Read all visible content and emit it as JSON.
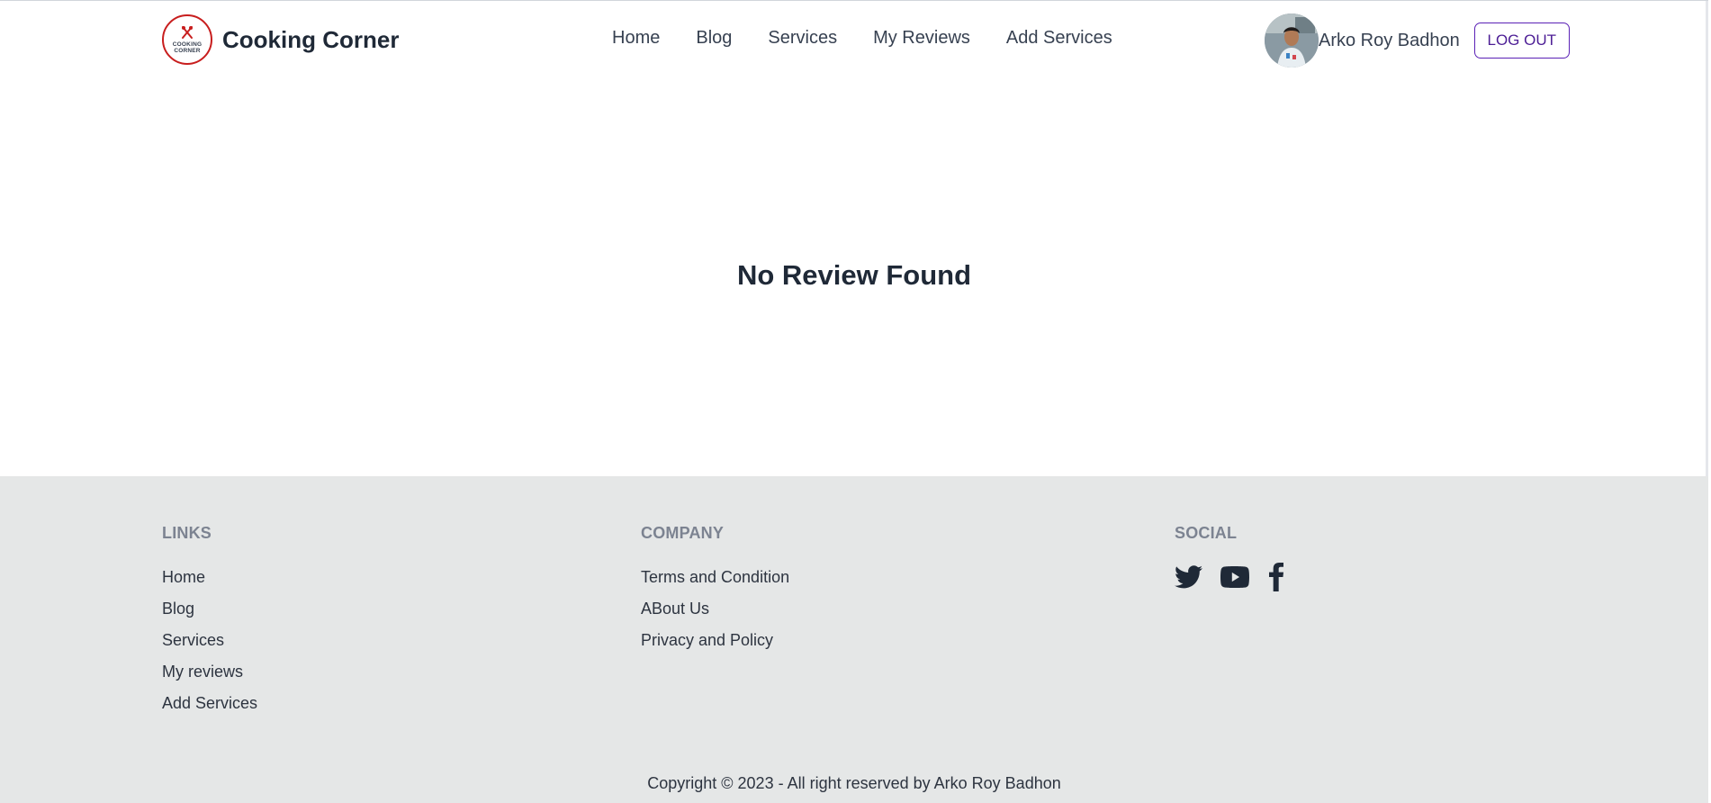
{
  "brand": {
    "name": "Cooking Corner",
    "logo_text_line1": "COOKING",
    "logo_text_line2": "CORNER",
    "logo_color": "#c81e1e"
  },
  "nav": {
    "items": [
      {
        "label": "Home"
      },
      {
        "label": "Blog"
      },
      {
        "label": "Services"
      },
      {
        "label": "My Reviews"
      },
      {
        "label": "Add Services"
      }
    ]
  },
  "user": {
    "name": "Arko Roy Badhon",
    "avatar_icon": "user-photo",
    "logout_label": "LOG OUT",
    "logout_color": "#5b21b6"
  },
  "main": {
    "message": "No Review Found"
  },
  "footer": {
    "links": {
      "title": "LINKS",
      "items": [
        "Home",
        "Blog",
        "Services",
        "My reviews",
        "Add Services"
      ]
    },
    "company": {
      "title": "COMPANY",
      "items": [
        "Terms and Condition",
        "ABout Us",
        "Privacy and Policy"
      ]
    },
    "social": {
      "title": "SOCIAL",
      "icons": [
        "twitter-icon",
        "youtube-icon",
        "facebook-icon"
      ]
    },
    "copyright": "Copyright © 2023 - All right reserved by Arko Roy Badhon",
    "background": "#e5e7e7"
  }
}
